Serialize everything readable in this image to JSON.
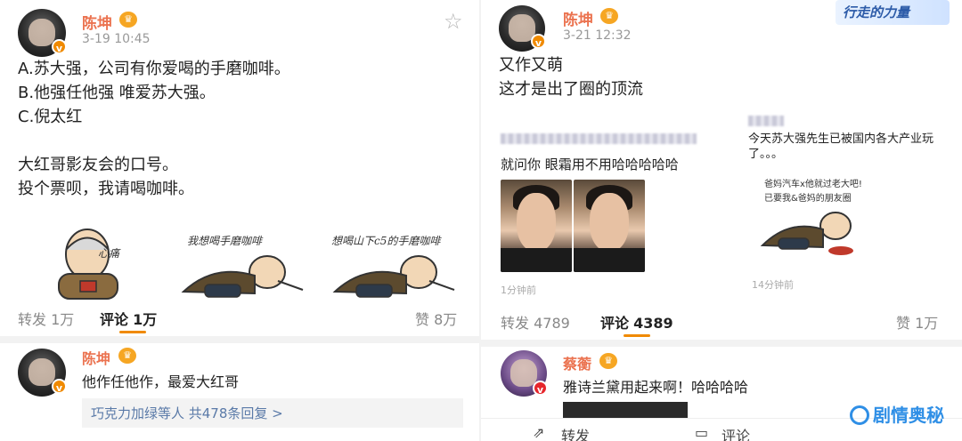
{
  "left": {
    "post": {
      "author": "陈坤",
      "time": "3-19 10:45",
      "text": "A.苏大强，公司有你爱喝的手磨咖啡。\nB.他强任他强 唯爱苏大强。\nC.倪太红\n\n大红哥影友会的口号。\n投个票呗，我请喝咖啡。",
      "images": [
        {
          "caption": "心痛"
        },
        {
          "caption": "我想喝手磨咖啡"
        },
        {
          "caption": "想喝山下c5的手磨咖啡"
        }
      ],
      "repost_label": "转发",
      "repost_count": "1万",
      "comment_label": "评论",
      "comment_count": "1万",
      "like_label": "赞",
      "like_count": "8万"
    },
    "comment": {
      "author": "陈坤",
      "text": "他作任他作，最爱大红哥",
      "more": "巧克力加绿等人  共478条回复 >"
    }
  },
  "right": {
    "badge": "行走的力量",
    "post": {
      "author": "陈坤",
      "time": "3-21 12:32",
      "text": "又作又萌\n这才是出了圈的顶流",
      "embed1": {
        "text": "就问你 眼霜用不用哈哈哈哈哈",
        "time": "1分钟前"
      },
      "embed2": {
        "text": "今天苏大强先生已被国内各大产业玩了。。。",
        "caption1": "爸妈汽车x他就过老大吧!",
        "caption2": "已要我&爸妈的朋友圈",
        "time": "14分钟前"
      },
      "repost_label": "转发",
      "repost_count": "4789",
      "comment_label": "评论",
      "comment_count": "4389",
      "like_label": "赞",
      "like_count": "1万"
    },
    "comment": {
      "author": "蔡蘅",
      "text": "雅诗兰黛用起来啊！哈哈哈哈"
    },
    "bottom": {
      "repost": "转发",
      "comment": "评论"
    }
  },
  "brand": "剧情奥秘",
  "colors": {
    "name": "#eb7350",
    "accent": "#f08a00",
    "link": "#5a7aa8",
    "brand": "#2f8fe6"
  },
  "icons": [
    "star-icon",
    "verified-badge-icon",
    "crown-icon",
    "repost-icon",
    "comment-icon",
    "brand-icon"
  ]
}
